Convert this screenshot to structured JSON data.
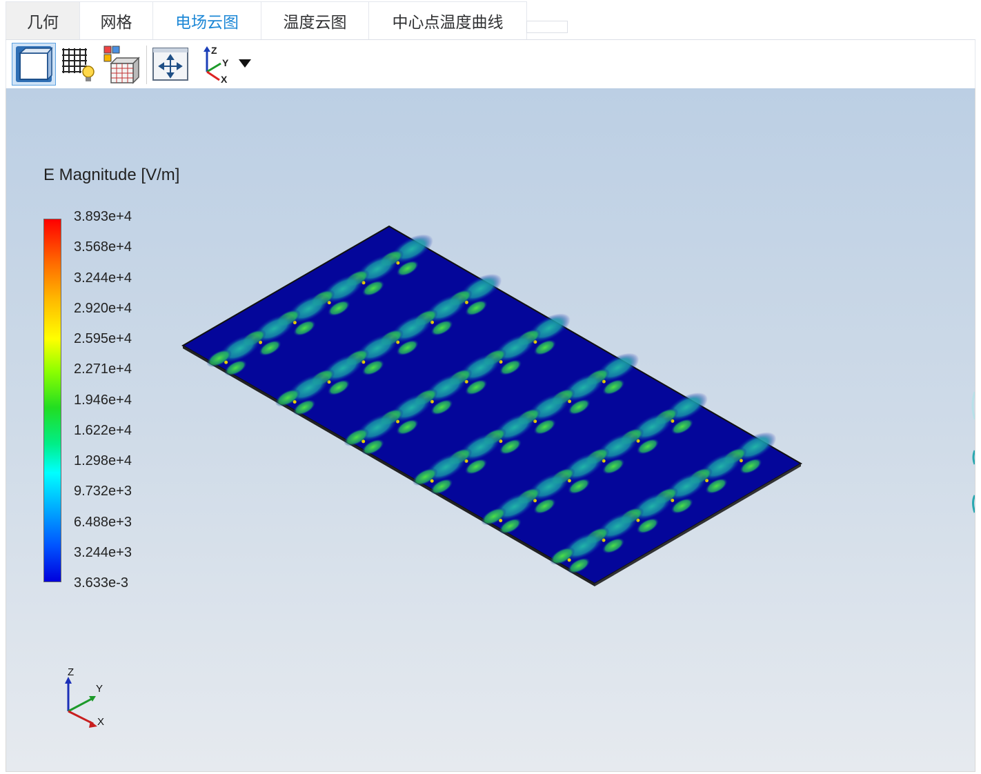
{
  "tabs": [
    {
      "label": "几何"
    },
    {
      "label": "网格"
    },
    {
      "label": "电场云图"
    },
    {
      "label": "温度云图"
    },
    {
      "label": "中心点温度曲线"
    }
  ],
  "active_tab": "电场云图",
  "toolbar": {
    "buttons": [
      {
        "name": "view-cube",
        "icon": "view-cube-icon",
        "selected": true
      },
      {
        "name": "mesh-toggle",
        "icon": "mesh-bulb-icon"
      },
      {
        "name": "mesh-3d",
        "icon": "mesh-box-icon"
      },
      {
        "name": "fit-view",
        "icon": "fit-view-icon"
      },
      {
        "name": "axes-view",
        "icon": "axes-triad-icon"
      }
    ],
    "axes_labels": {
      "z": "Z",
      "y": "Y",
      "x": "X"
    }
  },
  "legend": {
    "title": "E Magnitude [V/m]",
    "ticks": [
      "3.893e+4",
      "3.568e+4",
      "3.244e+4",
      "2.920e+4",
      "2.595e+4",
      "2.271e+4",
      "1.946e+4",
      "1.622e+4",
      "1.298e+4",
      "9.732e+3",
      "6.488e+3",
      "3.244e+3",
      "3.633e-3"
    ],
    "colors": {
      "top": "#ff0000",
      "orange": "#ff9900",
      "yellow": "#ffff00",
      "green": "#22cc22",
      "cyan": "#00ffff",
      "blue": "#0077ff",
      "bottom": "#0000dd"
    }
  },
  "plate": {
    "grid_rows": 6,
    "grid_cols": 6,
    "base_color": "#0a10a8",
    "spot_color": "#1aa0a0",
    "hot_color": "#2ecc40"
  },
  "triad": {
    "z": "Z",
    "y": "Y",
    "x": "X"
  }
}
